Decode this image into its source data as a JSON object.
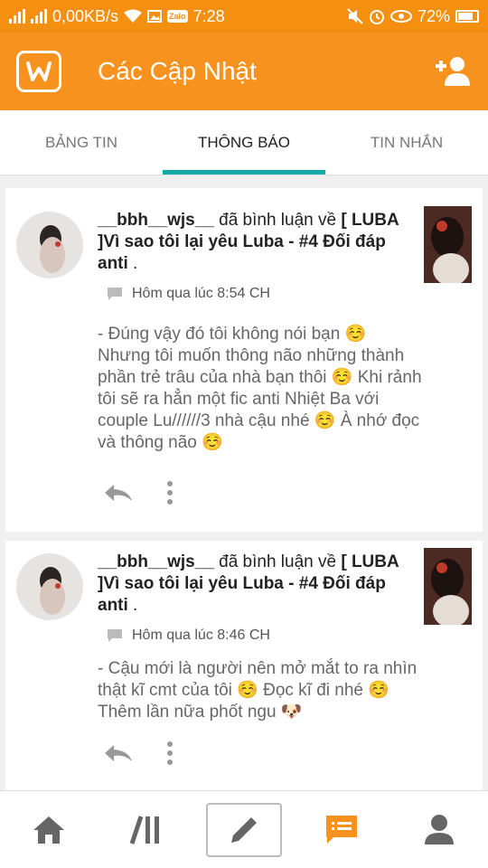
{
  "status": {
    "speed": "0,00KB/s",
    "carrier_badge": "Zalo",
    "time": "7:28",
    "battery": "72%"
  },
  "header": {
    "title": "Các Cập Nhật"
  },
  "tabs": [
    {
      "label": "BẢNG TIN"
    },
    {
      "label": "THÔNG BÁO"
    },
    {
      "label": "TIN NHẮN"
    }
  ],
  "notifications": [
    {
      "user": "__bbh__wjs__",
      "action": " đã bình luận về ",
      "story": "[ LUBA ]Vì sao tôi lại yêu Luba - #4 Đối đáp anti",
      "end": " .",
      "time": "Hôm qua lúc 8:54 CH",
      "body": "- Đúng vậy đó tôi không nói bạn ☺️ Nhưng tôi muốn thông não những thành phần trẻ trâu của nhà bạn thôi ☺️ Khi rảnh tôi sẽ ra hẳn một fic anti Nhiệt Ba với couple Lu//////3 nhà cậu nhé ☺️ À nhớ đọc và thông não ☺️"
    },
    {
      "user": "__bbh__wjs__",
      "action": " đã bình luận về ",
      "story": "[ LUBA ]Vì sao tôi lại yêu Luba - #4 Đối đáp anti",
      "end": " .",
      "time": "Hôm qua lúc 8:46 CH",
      "body": "- Cậu mới là người nên mở mắt to ra nhìn thật kĩ cmt của tôi ☺️ Đọc kĩ đi nhé ☺️ Thêm lần nữa phốt ngu 🐶"
    }
  ],
  "colors": {
    "brand": "#f7921e",
    "tab_indicator": "#17a9a5",
    "active_nav": "#f7921e",
    "inactive_nav": "#666666"
  }
}
